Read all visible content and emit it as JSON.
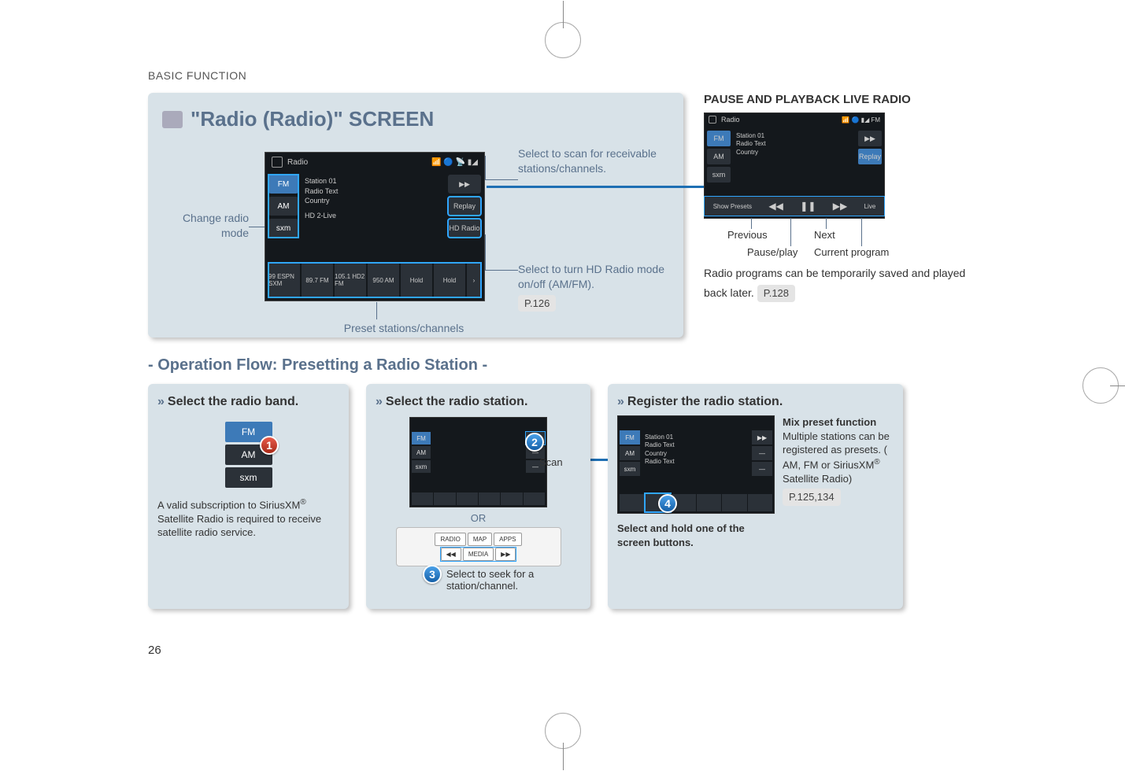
{
  "section_label": "BASIC FUNCTION",
  "page_number": "26",
  "main_panel": {
    "title": "\"Radio (Radio)\" SCREEN",
    "annot_change_mode": "Change radio mode",
    "annot_scan": "Select to scan for receivable stations/channels.",
    "annot_hd": "Select to turn HD Radio mode on/off (AM/FM).",
    "annot_hd_ref": "P.126",
    "annot_presets": "Preset stations/channels",
    "screenshot": {
      "header": "Radio",
      "bands": [
        "FM",
        "AM",
        "sxm"
      ],
      "info_lines": [
        "Station 01",
        "Radio Text",
        "Country",
        "HD 2-Live"
      ],
      "right_buttons": [
        "▶▶",
        "Replay",
        "HD Radio"
      ],
      "presets": [
        "99 ESPN\nSXM",
        "89.7\nFM",
        "105.1 HD2\nFM",
        "950\nAM",
        "Hold",
        "Hold"
      ]
    }
  },
  "right_col": {
    "title": "PAUSE AND PLAYBACK LIVE RADIO",
    "labels": {
      "prev": "Previous",
      "pause": "Pause/play",
      "next": "Next",
      "cur": "Current program"
    },
    "screenshot": {
      "header": "Radio",
      "bands": [
        "FM",
        "AM",
        "sxm"
      ],
      "info_lines": [
        "Station 01",
        "Radio Text",
        "Country"
      ],
      "right_buttons": [
        "▶▶",
        "Replay"
      ],
      "ctrl_row": [
        "Show Presets",
        "◀◀",
        "❚❚",
        "▶▶",
        "Live"
      ]
    },
    "desc_1": "Radio programs can be temporarily saved and played back later.",
    "desc_ref": "P.128"
  },
  "flow_title": "- Operation Flow: Presetting a Radio Station -",
  "step1": {
    "head": "Select the radio band.",
    "bands": [
      "FM",
      "AM",
      "sxm"
    ],
    "badge": "1",
    "note": "A valid subscription to SiriusXM® Satellite Radio is required to receive satellite radio service."
  },
  "step2": {
    "head": "Select the radio station.",
    "scan_label": "Scan",
    "or_label": "OR",
    "seek_label": "Select to seek for a station/channel.",
    "badge_scan": "2",
    "badge_seek": "3",
    "hw_buttons": [
      "RADIO",
      "MAP",
      "APPS",
      "◀◀",
      "MEDIA",
      "▶▶"
    ]
  },
  "step3": {
    "head": "Register the radio station.",
    "badge": "4",
    "hold_note": "Select and hold one of the screen buttons.",
    "mix_title": "Mix preset function",
    "mix_body": "Multiple stations can be registered as presets. ( AM, FM or SiriusXM® Satellite Radio)",
    "mix_ref": "P.125,134"
  }
}
